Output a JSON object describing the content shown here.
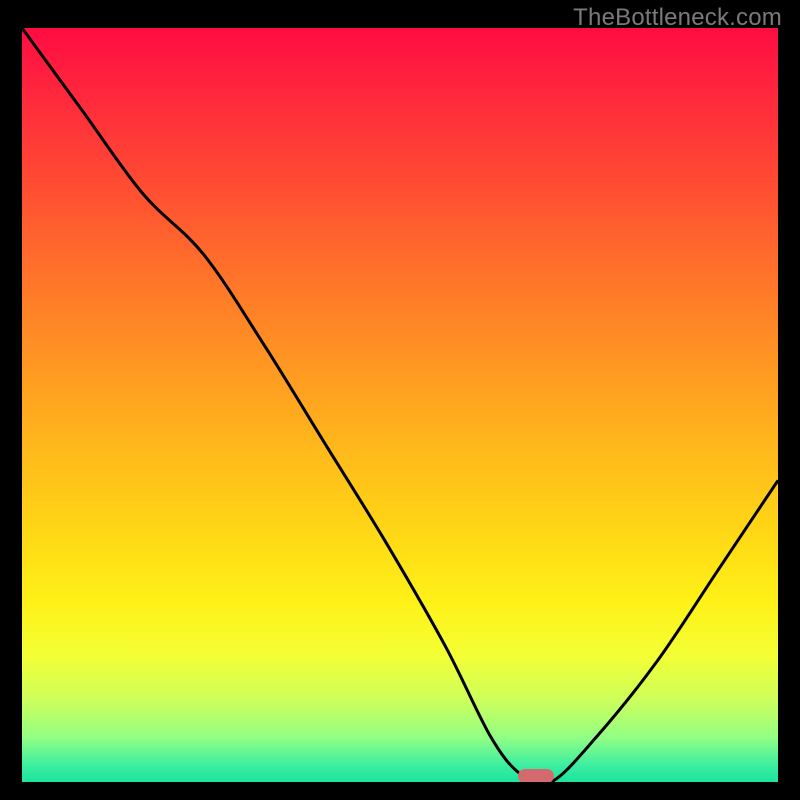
{
  "watermark": "TheBottleneck.com",
  "colors": {
    "frame": "#000000",
    "curve": "#000000",
    "marker": "#d46a6d",
    "watermark": "#7a7a7a"
  },
  "chart_data": {
    "type": "line",
    "title": "",
    "xlabel": "",
    "ylabel": "",
    "xlim": [
      0,
      100
    ],
    "ylim": [
      0,
      100
    ],
    "grid": false,
    "series": [
      {
        "name": "bottleneck-curve",
        "x": [
          0,
          8,
          16,
          24,
          32,
          40,
          48,
          56,
          62,
          66,
          70,
          76,
          84,
          92,
          100
        ],
        "values": [
          100,
          89,
          78,
          70,
          58,
          45,
          32,
          18,
          6,
          1,
          0,
          6,
          16,
          28,
          40
        ]
      }
    ],
    "marker": {
      "x": 68,
      "y": 0.8
    },
    "gradient_stops": [
      {
        "pos": 0,
        "color": "#ff0c42"
      },
      {
        "pos": 18,
        "color": "#ff4335"
      },
      {
        "pos": 42,
        "color": "#ff8f24"
      },
      {
        "pos": 66,
        "color": "#ffd516"
      },
      {
        "pos": 83,
        "color": "#f4ff33"
      },
      {
        "pos": 94,
        "color": "#93ff83"
      },
      {
        "pos": 100,
        "color": "#1de49d"
      }
    ]
  }
}
